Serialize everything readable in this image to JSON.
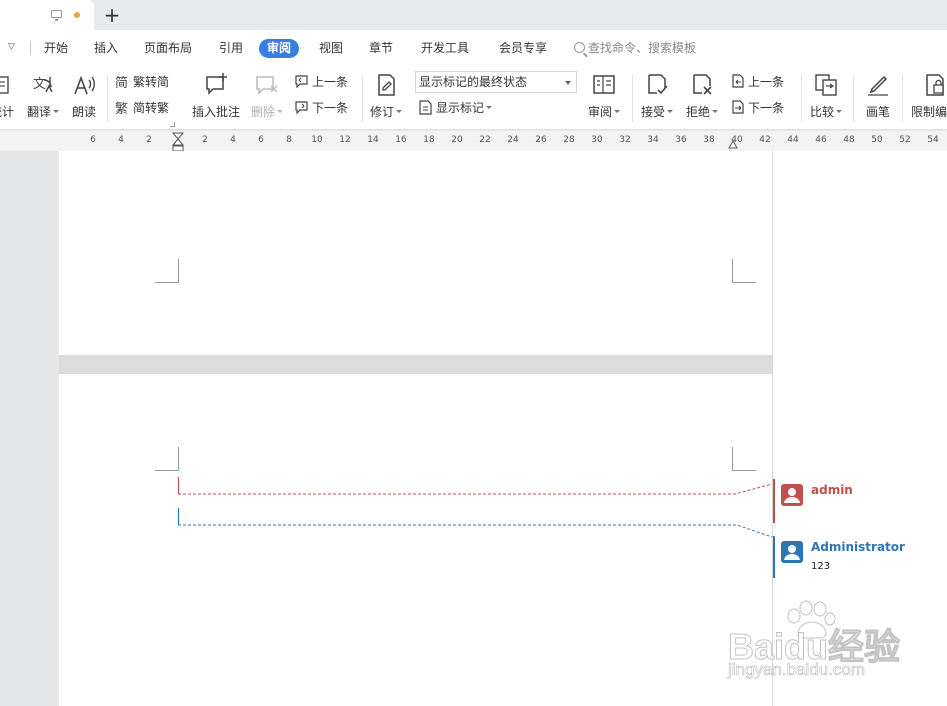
{
  "titlebar": {
    "new_tab_symbol": "+"
  },
  "menu": {
    "collapse_symbol": "▽",
    "items": [
      {
        "label": "开始"
      },
      {
        "label": "插入"
      },
      {
        "label": "页面布局"
      },
      {
        "label": "引用"
      },
      {
        "label": "审阅",
        "active": true
      },
      {
        "label": "视图"
      },
      {
        "label": "章节"
      },
      {
        "label": "开发工具"
      },
      {
        "label": "会员专享"
      }
    ],
    "search_placeholder": "查找命令、搜索模板"
  },
  "toolbar": {
    "stats_label": "统计",
    "translate_label": "翻译",
    "read_aloud_label": "朗读",
    "trad_to_simp_label": "繁转简",
    "simp_to_trad_label": "简转繁",
    "insert_comment_label": "插入批注",
    "delete_label": "删除",
    "prev_comment_label": "上一条",
    "next_comment_label": "下一条",
    "track_changes_label": "修订",
    "markup_state_value": "显示标记的最终状态",
    "show_markup_label": "显示标记",
    "review_pane_label": "审阅",
    "accept_label": "接受",
    "reject_label": "拒绝",
    "prev_change_label": "上一条",
    "next_change_label": "下一条",
    "compare_label": "比较",
    "pen_label": "画笔",
    "restrict_label": "限制编辑"
  },
  "ruler": {
    "ticks": [
      "6",
      "4",
      "2",
      "2",
      "4",
      "6",
      "8",
      "10",
      "12",
      "14",
      "16",
      "18",
      "20",
      "22",
      "24",
      "26",
      "28",
      "30",
      "32",
      "34",
      "36",
      "38",
      "40",
      "42",
      "44",
      "46",
      "48",
      "50",
      "52",
      "54"
    ]
  },
  "comments": [
    {
      "author": "admin",
      "text": "",
      "color": "#c0504d"
    },
    {
      "author": "Administrator",
      "text": "123",
      "color": "#2e75b6"
    }
  ],
  "watermark": {
    "line1": "Baidu经验",
    "line2": "jingyan.baidu.com"
  },
  "colors": {
    "accent": "#3a7de0",
    "comment_admin": "#c0504d",
    "comment_administrator": "#2e75b6"
  }
}
